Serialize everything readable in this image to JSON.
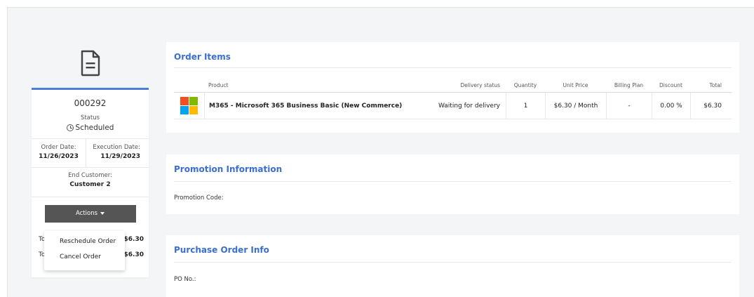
{
  "order": {
    "number": "000292",
    "status_label": "Status",
    "status_value": "Scheduled",
    "order_date_label": "Order Date:",
    "order_date": "11/26/2023",
    "execution_date_label": "Execution Date:",
    "execution_date": "11/29/2023",
    "end_customer_label": "End Customer:",
    "end_customer": "Customer 2",
    "actions_label": "Actions"
  },
  "totals": [
    {
      "label": "To",
      "value": "$6.30"
    },
    {
      "label": "To",
      "value": "$6.30"
    }
  ],
  "actions_menu": {
    "items": [
      "Reschedule Order",
      "Cancel Order"
    ]
  },
  "order_items": {
    "title": "Order Items",
    "columns": [
      "Product",
      "Delivery status",
      "Quantity",
      "Unit Price",
      "Billing Plan",
      "Discount",
      "Total"
    ],
    "rows": [
      {
        "product": "M365 - Microsoft 365 Business Basic (New Commerce)",
        "delivery_status": "Waiting for delivery",
        "quantity": "1",
        "unit_price": "$6.30 / Month",
        "billing_plan": "-",
        "discount": "0.00 %",
        "total": "$6.30"
      }
    ]
  },
  "promotion": {
    "title": "Promotion Information",
    "code_label": "Promotion Code:"
  },
  "purchase_order": {
    "title": "Purchase Order Info",
    "po_label": "PO No.:"
  },
  "colors": {
    "accent": "#3a6fd0",
    "card_top": "#4a7fd4",
    "button": "#555555",
    "ms_red": "#f25022",
    "ms_green": "#7fba00",
    "ms_blue": "#00a4ef",
    "ms_yellow": "#ffb900"
  },
  "icons": {
    "order_document": "document-icon",
    "status_clock": "clock-icon",
    "actions_caret": "caret-down-icon",
    "product_logo": "microsoft-logo-icon"
  }
}
